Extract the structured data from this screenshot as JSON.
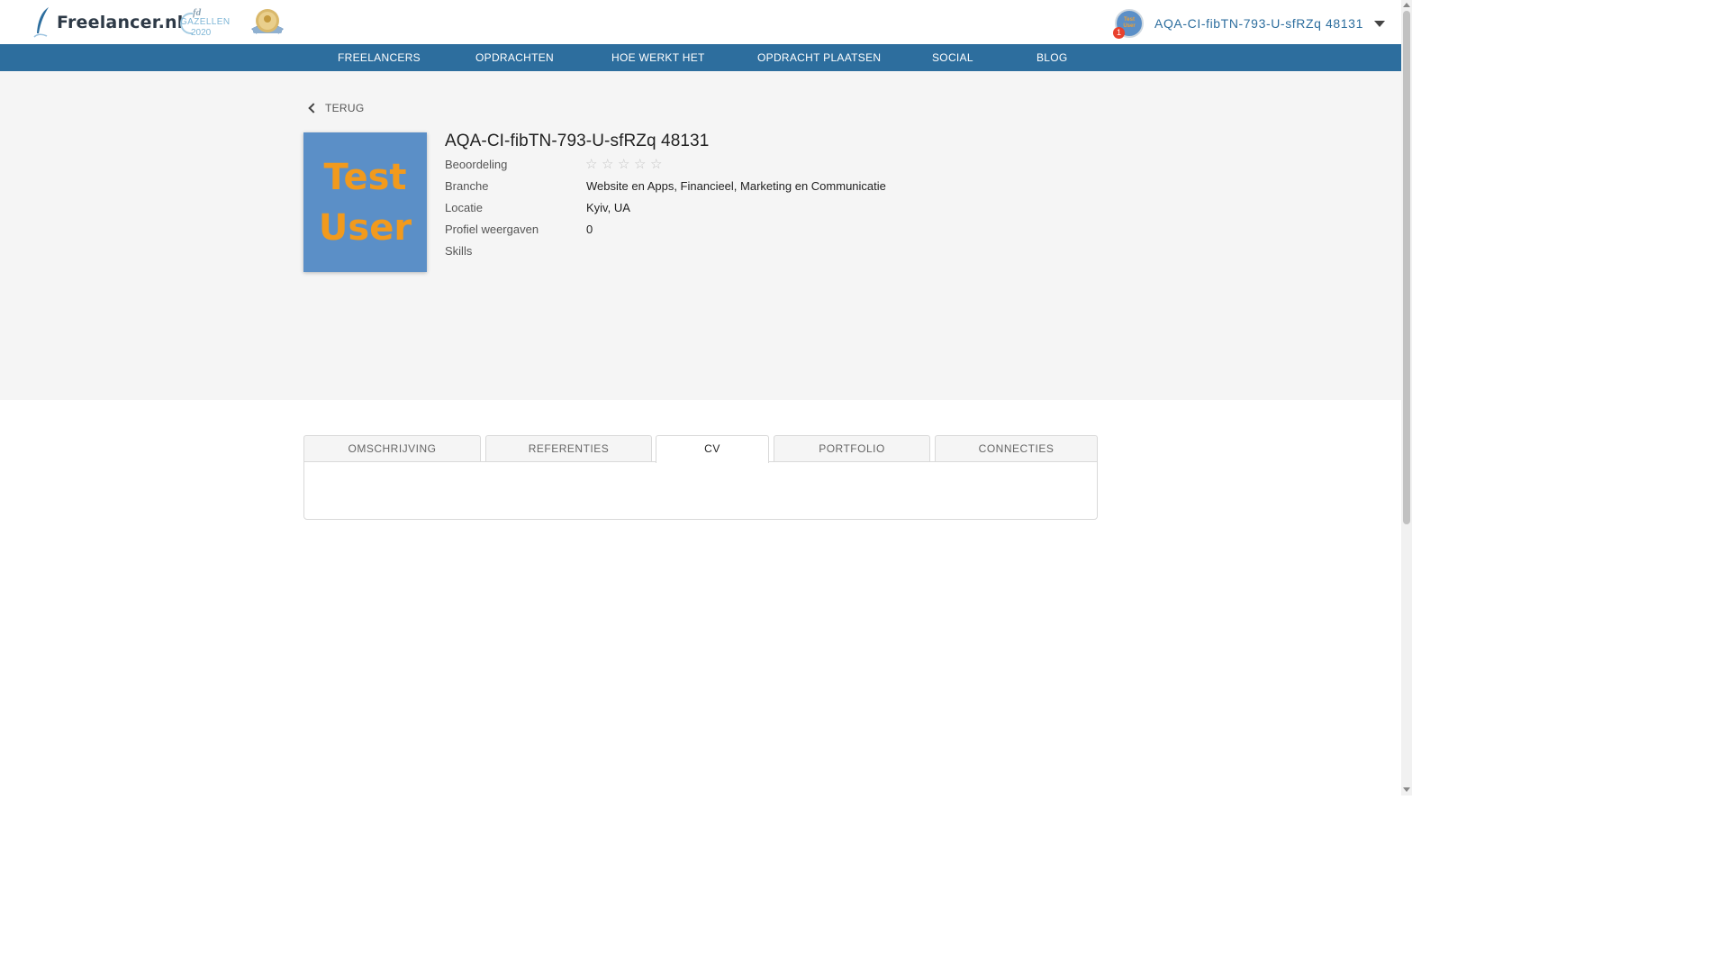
{
  "header": {
    "logo_text": "Freelancer.nl",
    "badge_gazellen": {
      "top": "fd",
      "middle": "GAZELLEN",
      "year": "2020"
    },
    "user": {
      "name": "AQA-CI-fibTN-793-U-sfRZq 48131",
      "notifications": "1",
      "avatar_text": "Test User"
    }
  },
  "nav": {
    "items": [
      "FREELANCERS",
      "OPDRACHTEN",
      "HOE WERKT HET",
      "OPDRACHT PLAATSEN",
      "SOCIAL",
      "BLOG"
    ]
  },
  "profile": {
    "back_label": "TERUG",
    "photo_lines": [
      "Test",
      "User"
    ],
    "name": "AQA-CI-fibTN-793-U-sfRZq 48131",
    "rating": {
      "label": "Beoordeling",
      "stars_filled": 0,
      "stars_total": 5
    },
    "branche": {
      "label": "Branche",
      "value": "Website en Apps, Financieel, Marketing en Communicatie"
    },
    "locatie": {
      "label": "Locatie",
      "value": "Kyiv, UA"
    },
    "weergaven": {
      "label": "Profiel weergaven",
      "value": "0"
    },
    "skills": {
      "label": "Skills",
      "value": ""
    }
  },
  "tabs": {
    "items": [
      "OMSCHRIJVING",
      "REFERENTIES",
      "CV",
      "PORTFOLIO",
      "CONNECTIES"
    ],
    "active": "CV"
  },
  "colors": {
    "brand_blue": "#2d6e9e",
    "photo_bg": "#5b8fc7",
    "photo_text": "#f29a1d",
    "notification": "#e8412d"
  },
  "icons": [
    "feather-logo-icon",
    "award-badge-icon",
    "chevron-down-icon",
    "chevron-left-icon",
    "star-icon"
  ]
}
